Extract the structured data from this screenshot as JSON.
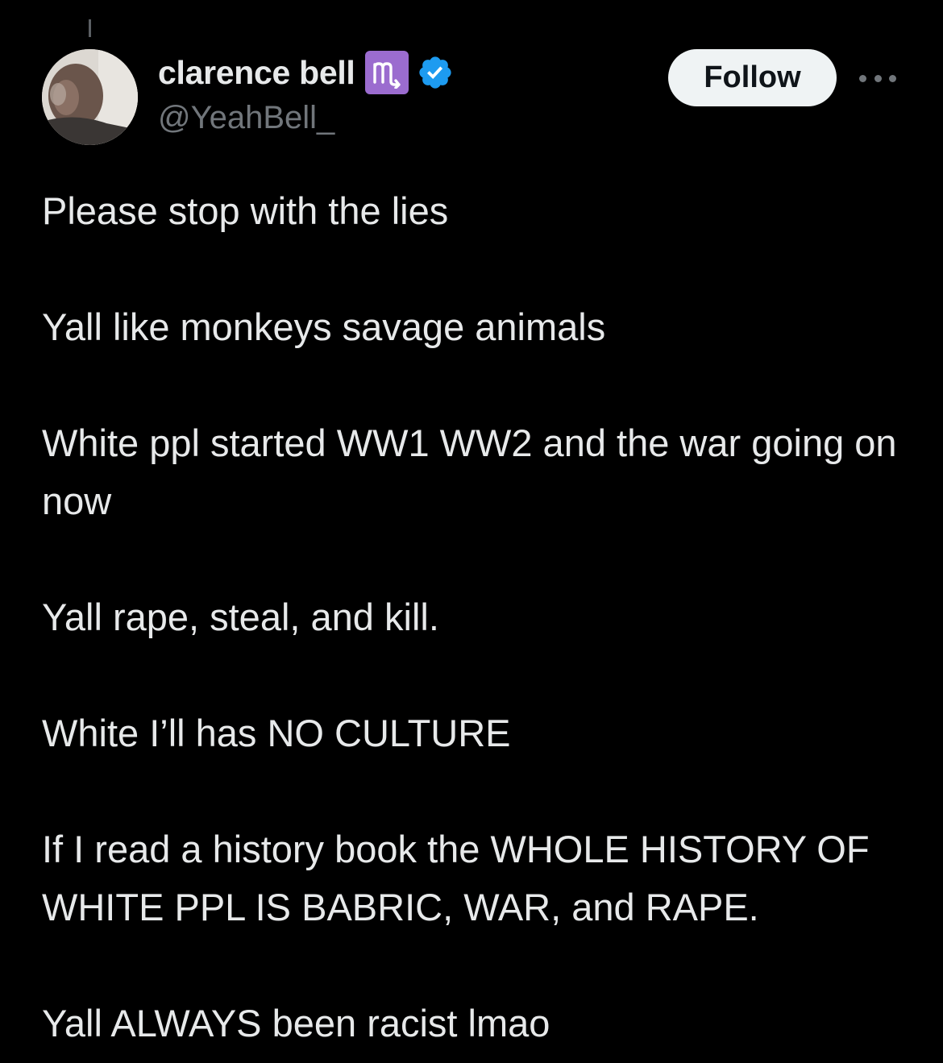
{
  "author": {
    "display_name": "clarence bell",
    "handle": "@YeahBell_",
    "zodiac_glyph": "♏",
    "badges": [
      "scorpio-emoji",
      "verified-badge-icon"
    ],
    "verified_color": "#1d9bf0",
    "zodiac_badge_color": "#9b6ccf"
  },
  "actions": {
    "follow_label": "Follow",
    "more_icon": "more-horizontal-icon"
  },
  "tweet": {
    "paragraphs": [
      "Please stop with the lies",
      "Yall like monkeys savage animals",
      "White ppl started WW1 WW2 and the war going on now",
      "Yall rape, steal, and kill.",
      "White I’ll has NO CULTURE",
      "If I read a history book the WHOLE HISTORY OF WHITE PPL IS BABRIC, WAR, and RAPE.",
      "Yall ALWAYS been racist lmao"
    ]
  },
  "colors": {
    "background": "#000000",
    "text_primary": "#e7e9ea",
    "text_secondary": "#71767b",
    "follow_bg": "#eff3f4"
  }
}
